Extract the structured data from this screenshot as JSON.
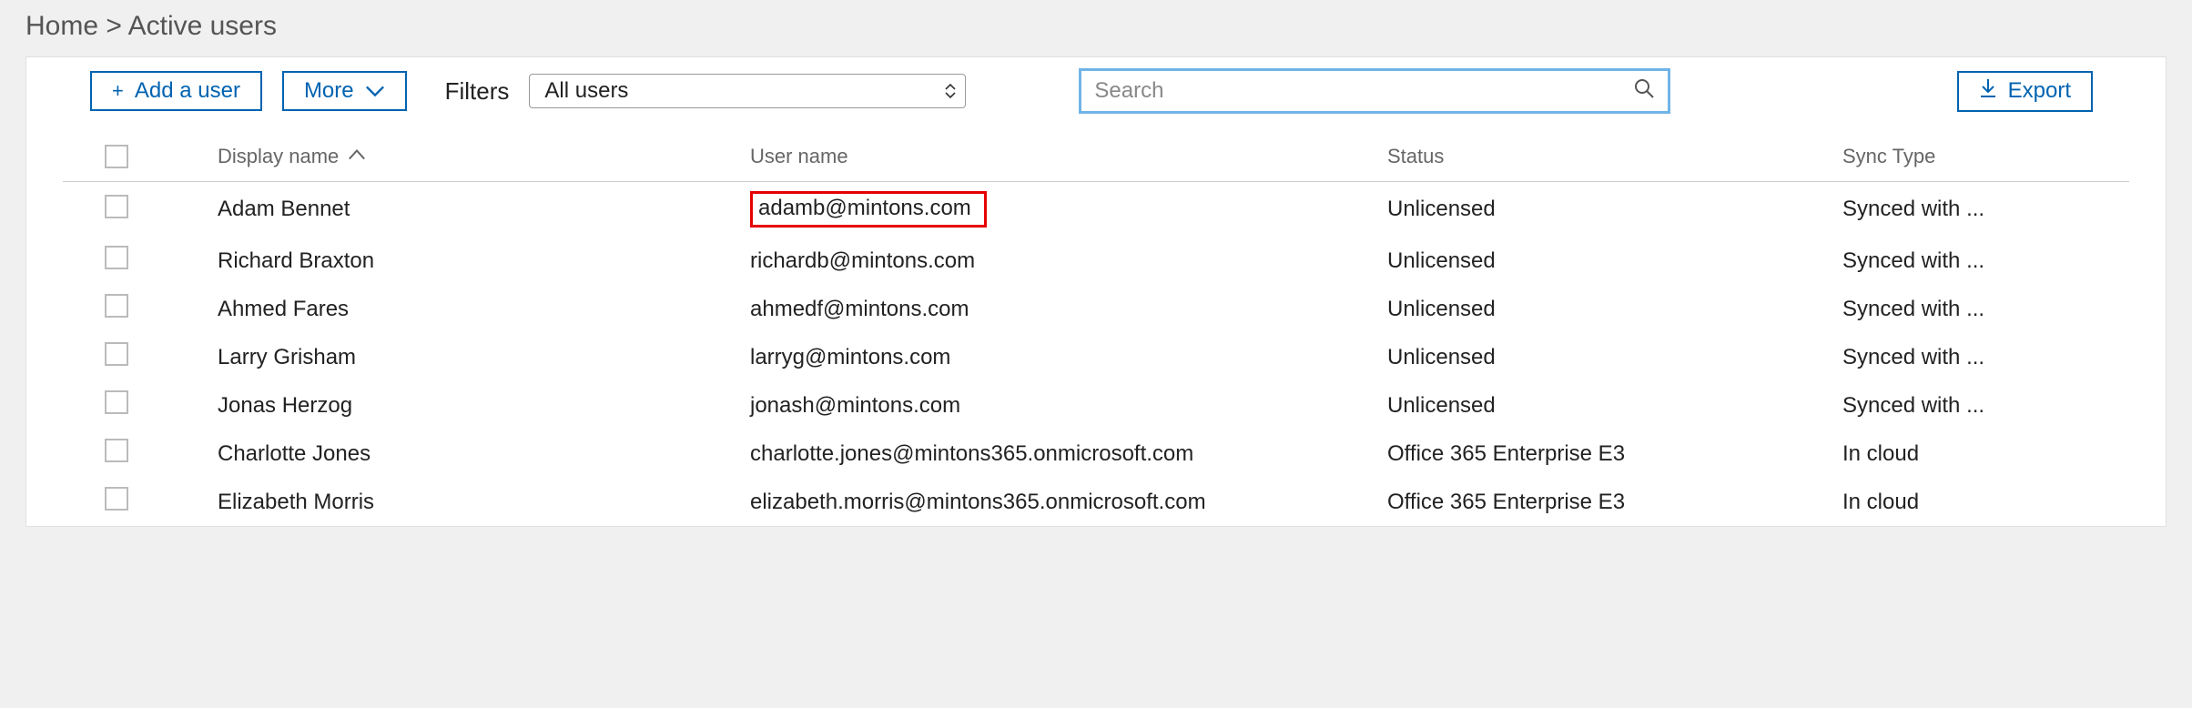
{
  "breadcrumb": {
    "home": "Home",
    "sep": ">",
    "current": "Active users"
  },
  "toolbar": {
    "add_user_label": "Add a user",
    "more_label": "More",
    "filters_label": "Filters",
    "filter_selected": "All users",
    "search_placeholder": "Search",
    "export_label": "Export"
  },
  "table": {
    "columns": {
      "display_name": "Display name",
      "user_name": "User name",
      "status": "Status",
      "sync_type": "Sync Type"
    },
    "rows": [
      {
        "display_name": "Adam Bennet",
        "user_name": "adamb@mintons.com",
        "status": "Unlicensed",
        "sync_type": "Synced with ...",
        "highlight_username": true
      },
      {
        "display_name": "Richard Braxton",
        "user_name": "richardb@mintons.com",
        "status": "Unlicensed",
        "sync_type": "Synced with ...",
        "highlight_username": false
      },
      {
        "display_name": "Ahmed Fares",
        "user_name": "ahmedf@mintons.com",
        "status": "Unlicensed",
        "sync_type": "Synced with ...",
        "highlight_username": false
      },
      {
        "display_name": "Larry Grisham",
        "user_name": "larryg@mintons.com",
        "status": "Unlicensed",
        "sync_type": "Synced with ...",
        "highlight_username": false
      },
      {
        "display_name": "Jonas Herzog",
        "user_name": "jonash@mintons.com",
        "status": "Unlicensed",
        "sync_type": "Synced with ...",
        "highlight_username": false
      },
      {
        "display_name": "Charlotte Jones",
        "user_name": "charlotte.jones@mintons365.onmicrosoft.com",
        "status": "Office 365 Enterprise E3",
        "sync_type": "In cloud",
        "highlight_username": false
      },
      {
        "display_name": "Elizabeth Morris",
        "user_name": "elizabeth.morris@mintons365.onmicrosoft.com",
        "status": "Office 365 Enterprise E3",
        "sync_type": "In cloud",
        "highlight_username": false
      }
    ]
  }
}
